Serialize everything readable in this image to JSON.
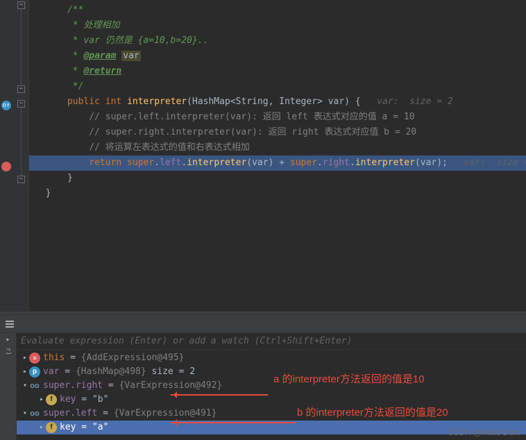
{
  "code": {
    "doc_open": "/**",
    "doc_line1_prefix": " * ",
    "doc_line1": "处理相加",
    "doc_line2_prefix": " * var ",
    "doc_line2_rest": "仍然是 {a=10,b=20}..",
    "doc_param_prefix": " * ",
    "doc_param_tag": "@param",
    "doc_param_name": "var",
    "doc_return_prefix": " * ",
    "doc_return_tag": "@return",
    "doc_close": " */",
    "kw_public": "public",
    "kw_int": "int",
    "method_name": "interpreter",
    "sig_open": "(",
    "type_hashmap": "HashMap",
    "type_generic_open": "<",
    "type_string": "String",
    "type_sep": ", ",
    "type_integer": "Integer",
    "type_generic_close": ">",
    "param_var": " var",
    "sig_close": ") {",
    "hint_sig": "   var:  size = 2",
    "cmt1": "// super.left.interpreter(var): 返回 left 表达式对应的值 a = 10",
    "cmt2": "// super.right.interpreter(var): 返回 right 表达式对应值 b = 20",
    "cmt3": "// 将运算左表达式的值和右表达式相加",
    "kw_return": "return",
    "kw_super1": "super",
    "dot": ".",
    "field_left": "left",
    "call_interpreter": "interpreter",
    "paren_open": "(",
    "arg_var": "var",
    "paren_close": ")",
    "plus": " + ",
    "kw_super2": "super",
    "field_right": "right",
    "semi": ";",
    "hint_ret": "   var:  size = ",
    "close_brace1": "}",
    "close_brace2": "}"
  },
  "debugger": {
    "watch_placeholder": "Evaluate expression (Enter) or add a watch (Ctrl+Shift+Enter)",
    "vars": {
      "this_name": "this",
      "this_val": "{AddExpression@495}",
      "var_name": "var",
      "var_val": "{HashMap@498} ",
      "var_size": "size = 2",
      "right_name": "super.right",
      "right_val": "{VarExpression@492}",
      "right_key_name": "key",
      "right_key_val": "\"b\"",
      "left_name": "super.left",
      "left_val": "{VarExpression@491}",
      "left_key_name": "key",
      "left_key_val": "\"a\""
    }
  },
  "annotations": {
    "a": "a 的interpreter方法返回的值是10",
    "b": "b 的interpreter方法返回的值是20"
  },
  "watermark": "CSDN @Hello Dam"
}
